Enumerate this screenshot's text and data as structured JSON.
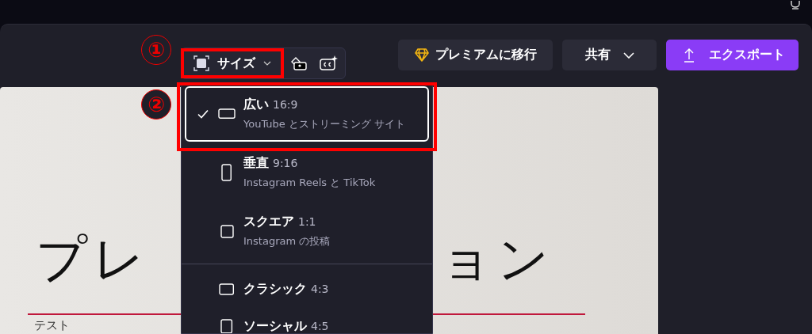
{
  "toolbar": {
    "size_button": {
      "label": "サイズ"
    }
  },
  "actions": {
    "premium": "プレミアムに移行",
    "share": "共有",
    "export": "エクスポート"
  },
  "size_menu": {
    "groups": [
      [
        {
          "label": "広い",
          "ratio": "16:9",
          "description": "YouTube とストリーミング サイト",
          "selected": true
        },
        {
          "label": "垂直",
          "ratio": "9:16",
          "description": "Instagram Reels と TikTok",
          "selected": false
        },
        {
          "label": "スクエア",
          "ratio": "1:1",
          "description": "Instagram の投稿",
          "selected": false
        }
      ],
      [
        {
          "label": "クラシック",
          "ratio": "4:3",
          "selected": false
        },
        {
          "label": "ソーシャル",
          "ratio": "4:5",
          "selected": false
        }
      ]
    ]
  },
  "slide": {
    "title_left": "プレ",
    "title_right": "ョン",
    "subtitle": "テスト"
  },
  "annotations": [
    {
      "label": "①"
    },
    {
      "label": "②"
    }
  ]
}
